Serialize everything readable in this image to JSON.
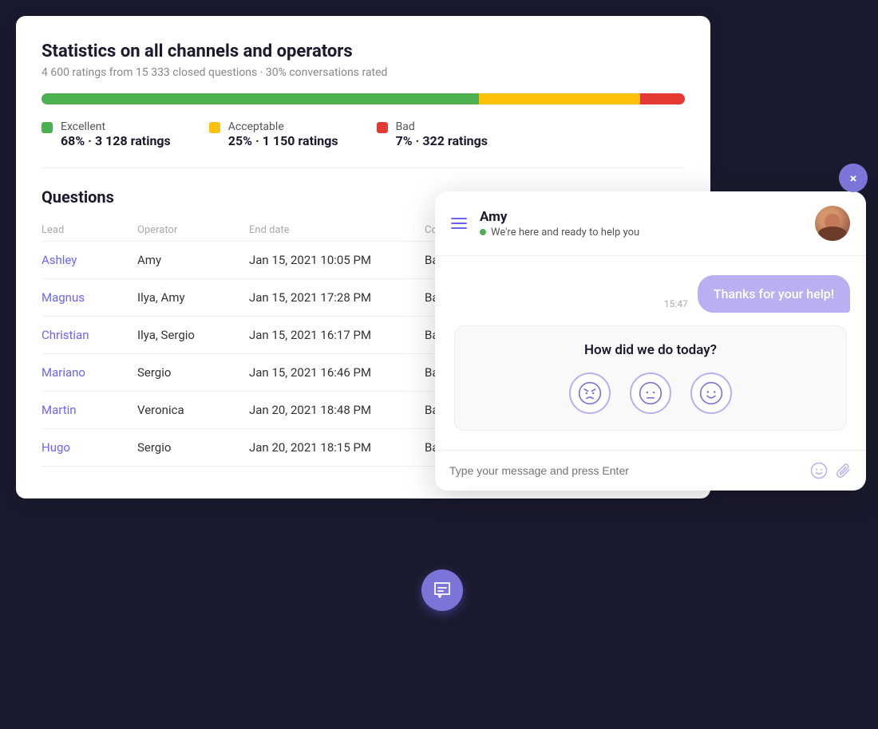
{
  "stats": {
    "title": "Statistics on all channels and operators",
    "subtitle": "4 600 ratings from 15 333 closed questions  ·  30% conversations rated",
    "bar": {
      "excellent_pct": 68,
      "acceptable_pct": 25,
      "bad_pct": 7
    },
    "excellent": {
      "label": "Excellent",
      "value": "68%",
      "detail": "3 128 ratings",
      "color": "#4caf50"
    },
    "acceptable": {
      "label": "Acceptable",
      "value": "25%",
      "detail": "1 150 ratings",
      "color": "#ffc107"
    },
    "bad": {
      "label": "Bad",
      "value": "7%",
      "detail": "322 ratings",
      "color": "#e53935"
    }
  },
  "questions": {
    "title": "Questions",
    "columns": {
      "lead": "Lead",
      "operator": "Operator",
      "end_date": "End date",
      "conversation": "Conversation"
    },
    "rows": [
      {
        "lead": "Ashley",
        "operator": "Amy",
        "end_date": "Jan 15, 2021 10:05 PM",
        "conversation": "Bad"
      },
      {
        "lead": "Magnus",
        "operator": "Ilya, Amy",
        "end_date": "Jan 15, 2021 17:28 PM",
        "conversation": "Bad"
      },
      {
        "lead": "Christian",
        "operator": "Ilya, Sergio",
        "end_date": "Jan 15, 2021 16:17 PM",
        "conversation": "Bad"
      },
      {
        "lead": "Mariano",
        "operator": "Sergio",
        "end_date": "Jan 15, 2021 16:46 PM",
        "conversation": "Bad"
      },
      {
        "lead": "Martin",
        "operator": "Veronica",
        "end_date": "Jan 20, 2021 18:48 PM",
        "conversation": "Bad"
      },
      {
        "lead": "Hugo",
        "operator": "Sergio",
        "end_date": "Jan 20, 2021 18:15 PM",
        "conversation": "Bad"
      }
    ]
  },
  "chat": {
    "header_name": "Amy",
    "status_text": "We're here and ready to help you",
    "message_time": "15:47",
    "message_text": "Thanks for your help!",
    "feedback_question": "How did we do today?",
    "input_placeholder": "Type your message and press Enter",
    "emojis": [
      "angry",
      "neutral",
      "happy"
    ]
  },
  "buttons": {
    "close": "×"
  }
}
